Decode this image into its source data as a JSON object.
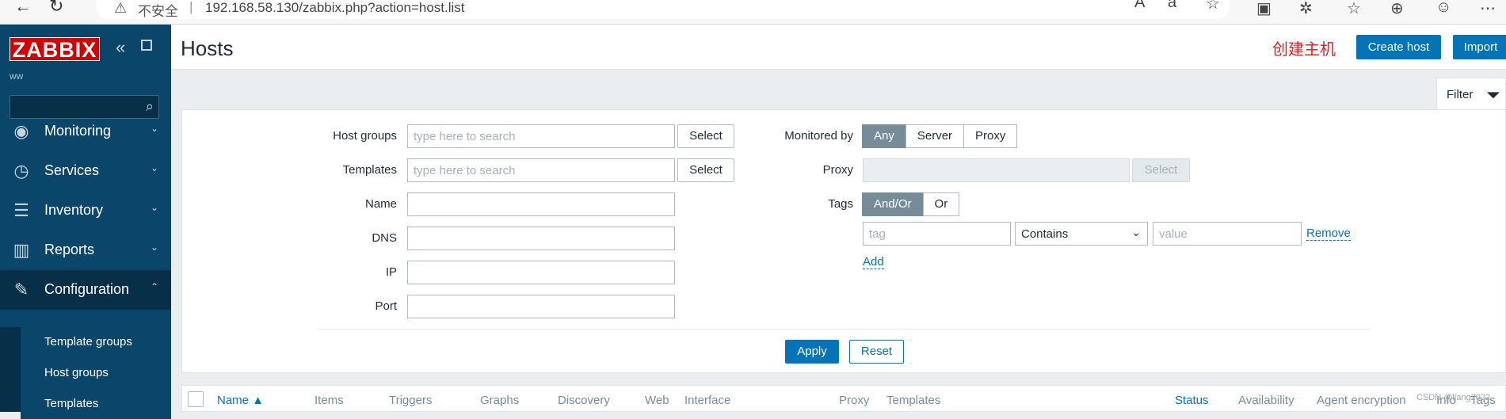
{
  "browser": {
    "insecure_label": "不安全",
    "url": "192.168.58.130/zabbix.php?action=host.list"
  },
  "sidebar": {
    "logo": "ZABBIX",
    "server_name": "ww",
    "menu": [
      {
        "label": "Monitoring",
        "icon": "eye-icon"
      },
      {
        "label": "Services",
        "icon": "clock-icon"
      },
      {
        "label": "Inventory",
        "icon": "list-icon"
      },
      {
        "label": "Reports",
        "icon": "bar-chart-icon"
      },
      {
        "label": "Configuration",
        "icon": "wrench-icon"
      }
    ],
    "submenu": [
      "Template groups",
      "Host groups",
      "Templates"
    ]
  },
  "header": {
    "title": "Hosts",
    "annotation": "创建主机",
    "create_host": "Create host",
    "import": "Import"
  },
  "filter": {
    "tab_label": "Filter",
    "host_groups_label": "Host groups",
    "templates_label": "Templates",
    "name_label": "Name",
    "dns_label": "DNS",
    "ip_label": "IP",
    "port_label": "Port",
    "search_placeholder": "type here to search",
    "select": "Select",
    "monitored_by_label": "Monitored by",
    "monitored_by_options": [
      "Any",
      "Server",
      "Proxy"
    ],
    "proxy_label": "Proxy",
    "tags_label": "Tags",
    "tags_options": [
      "And/Or",
      "Or"
    ],
    "tag_placeholder": "tag",
    "tag_operator": "Contains",
    "value_placeholder": "value",
    "remove": "Remove",
    "add": "Add",
    "apply": "Apply",
    "reset": "Reset"
  },
  "table": {
    "columns": [
      "Name ▲",
      "Items",
      "Triggers",
      "Graphs",
      "Discovery",
      "Web",
      "Interface",
      "Proxy",
      "Templates",
      "Status",
      "Availability",
      "Agent encryption",
      "Info",
      "Tags"
    ]
  },
  "watermark": "CSDN @liang2022"
}
